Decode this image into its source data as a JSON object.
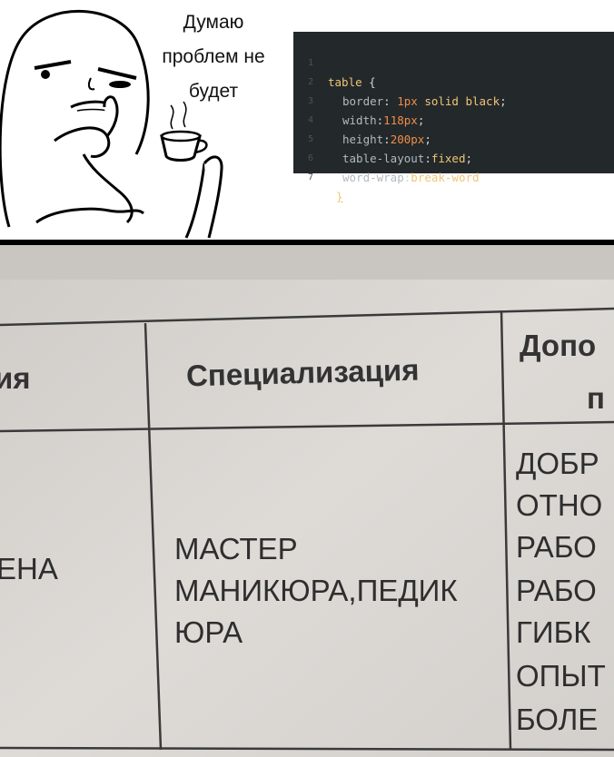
{
  "meme": {
    "caption_lines": [
      "Думаю",
      "проблем не",
      "будет"
    ]
  },
  "code": {
    "lines": [
      {
        "n": "1",
        "selector": "table",
        "punc": " {"
      },
      {
        "n": "2",
        "prop": "border",
        "value_num": "1px",
        "value_rest": " solid black"
      },
      {
        "n": "3",
        "prop": "width",
        "value_num": "118px",
        "value_rest": ""
      },
      {
        "n": "4",
        "prop": "height",
        "value_num": "200px",
        "value_rest": ""
      },
      {
        "n": "5",
        "prop": "table-layout",
        "value_num": "",
        "value_rest": "fixed"
      },
      {
        "n": "6",
        "prop": "word-wrap",
        "value_num": "",
        "value_rest": "break-word"
      },
      {
        "n": "7",
        "closing": "}"
      }
    ]
  },
  "photo": {
    "headers": [
      "ия",
      "Специализация",
      "Допо",
      "п"
    ],
    "left_cell": "ЕНА",
    "specialization_lines": [
      "МАСТЕР",
      "МАНИКЮРА,ПЕДИК",
      "ЮРА"
    ],
    "right_column_lines": [
      "ДОБР",
      "ОТНО",
      "РАБО",
      "РАБО",
      "ГИБК",
      "ОПЫТ",
      "БОЛЕ"
    ]
  }
}
